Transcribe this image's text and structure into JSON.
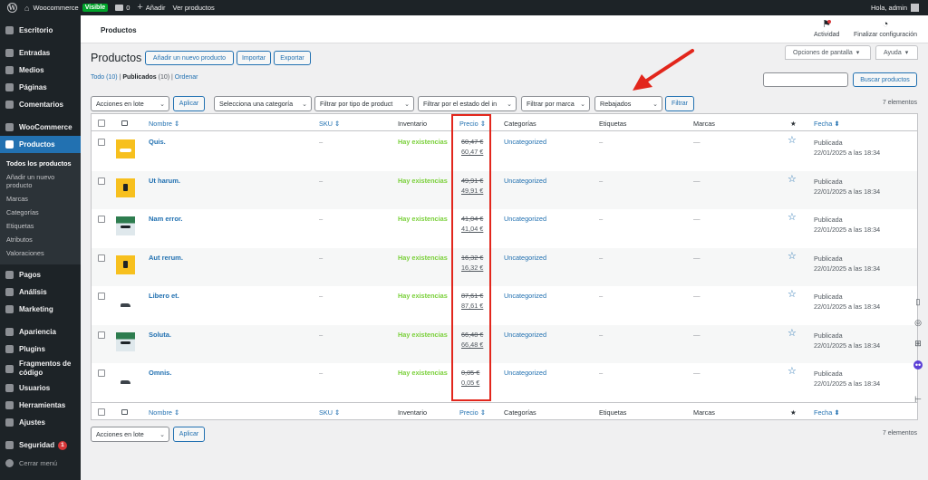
{
  "admin_bar": {
    "site_name": "Woocommerce",
    "visibility_badge": "Visible",
    "comments_count": "0",
    "new_label": "Añadir",
    "view_products": "Ver productos",
    "greeting": "Hola, admin"
  },
  "sidebar": {
    "items": [
      {
        "label": "Escritorio",
        "icon": "dashboard-icon"
      },
      {
        "label": "Entradas",
        "icon": "pin-icon"
      },
      {
        "label": "Medios",
        "icon": "media-icon"
      },
      {
        "label": "Páginas",
        "icon": "pages-icon"
      },
      {
        "label": "Comentarios",
        "icon": "comments-icon"
      },
      {
        "label": "WooCommerce",
        "icon": "woocommerce-icon"
      },
      {
        "label": "Productos",
        "icon": "products-icon"
      },
      {
        "label": "Pagos",
        "icon": "payments-icon"
      },
      {
        "label": "Análisis",
        "icon": "analytics-icon"
      },
      {
        "label": "Marketing",
        "icon": "marketing-icon"
      },
      {
        "label": "Apariencia",
        "icon": "appearance-icon"
      },
      {
        "label": "Plugins",
        "icon": "plugins-icon"
      },
      {
        "label": "Fragmentos de código",
        "icon": "snippets-icon"
      },
      {
        "label": "Usuarios",
        "icon": "users-icon"
      },
      {
        "label": "Herramientas",
        "icon": "tools-icon"
      },
      {
        "label": "Ajustes",
        "icon": "settings-icon"
      },
      {
        "label": "Seguridad",
        "icon": "security-icon",
        "badge": "1"
      }
    ],
    "submenu": [
      "Todos los productos",
      "Añadir un nuevo producto",
      "Marcas",
      "Categorías",
      "Etiquetas",
      "Atributos",
      "Valoraciones"
    ],
    "collapse_label": "Cerrar menú"
  },
  "header": {
    "page_title": "Productos",
    "activity_label": "Actividad",
    "finish_setup_label": "Finalizar configuración",
    "screen_options": "Opciones de pantalla",
    "help": "Ayuda"
  },
  "main": {
    "heading": "Productos",
    "add_new": "Añadir un nuevo producto",
    "import": "Importar",
    "export": "Exportar",
    "views": {
      "all": "Todo",
      "all_count": "(10)",
      "published": "Publicados",
      "published_count": "(10)",
      "sort": "Ordenar"
    },
    "search_button": "Buscar productos",
    "bulk_action": "Acciones en lote",
    "apply": "Aplicar",
    "filters": {
      "category": "Selecciona una categoría",
      "type": "Filtrar por tipo de product",
      "stock": "Filtrar por el estado del in",
      "brand": "Filtrar por marca",
      "sale": "Rebajados",
      "button": "Filtrar"
    },
    "count": "7 elementos"
  },
  "table": {
    "columns": {
      "name": "Nombre",
      "sku": "SKU",
      "stock": "Inventario",
      "price": "Precio",
      "categories": "Categorías",
      "tags": "Etiquetas",
      "brands": "Marcas",
      "featured": "★",
      "date": "Fecha"
    },
    "rows": [
      {
        "name": "Quis.",
        "sku": "–",
        "stock": "Hay existencias",
        "price_regular": "60,47 €",
        "price_sale": "60,47 €",
        "category": "Uncategorized",
        "tags": "–",
        "brands": "—",
        "status": "Publicada",
        "date": "22/01/2025 a las 18:34",
        "thumb": "yshoe"
      },
      {
        "name": "Ut harum.",
        "sku": "–",
        "stock": "Hay existencias",
        "price_regular": "49,91 €",
        "price_sale": "49,91 €",
        "category": "Uncategorized",
        "tags": "–",
        "brands": "—",
        "status": "Publicada",
        "date": "22/01/2025 a las 18:34",
        "thumb": "yellow"
      },
      {
        "name": "Nam error.",
        "sku": "–",
        "stock": "Hay existencias",
        "price_regular": "41,04 €",
        "price_sale": "41,04 €",
        "category": "Uncategorized",
        "tags": "–",
        "brands": "—",
        "status": "Publicada",
        "date": "22/01/2025 a las 18:34",
        "thumb": "scene"
      },
      {
        "name": "Aut rerum.",
        "sku": "–",
        "stock": "Hay existencias",
        "price_regular": "16,32 €",
        "price_sale": "16,32 €",
        "category": "Uncategorized",
        "tags": "–",
        "brands": "—",
        "status": "Publicada",
        "date": "22/01/2025 a las 18:34",
        "thumb": "yellow"
      },
      {
        "name": "Libero et.",
        "sku": "–",
        "stock": "Hay existencias",
        "price_regular": "87,61 €",
        "price_sale": "87,61 €",
        "category": "Uncategorized",
        "tags": "–",
        "brands": "—",
        "status": "Publicada",
        "date": "22/01/2025 a las 18:34",
        "thumb": "shoe"
      },
      {
        "name": "Soluta.",
        "sku": "–",
        "stock": "Hay existencias",
        "price_regular": "66,48 €",
        "price_sale": "66,48 €",
        "category": "Uncategorized",
        "tags": "–",
        "brands": "—",
        "status": "Publicada",
        "date": "22/01/2025 a las 18:34",
        "thumb": "scene"
      },
      {
        "name": "Omnis.",
        "sku": "–",
        "stock": "Hay existencias",
        "price_regular": "0,05 €",
        "price_sale": "0,05 €",
        "category": "Uncategorized",
        "tags": "–",
        "brands": "—",
        "status": "Publicada",
        "date": "22/01/2025 a las 18:34",
        "thumb": "shoe"
      }
    ]
  },
  "colors": {
    "accent": "#2271b1",
    "in_stock": "#7ad03a",
    "highlight": "#e2261c",
    "admin_bg": "#1d2327"
  }
}
